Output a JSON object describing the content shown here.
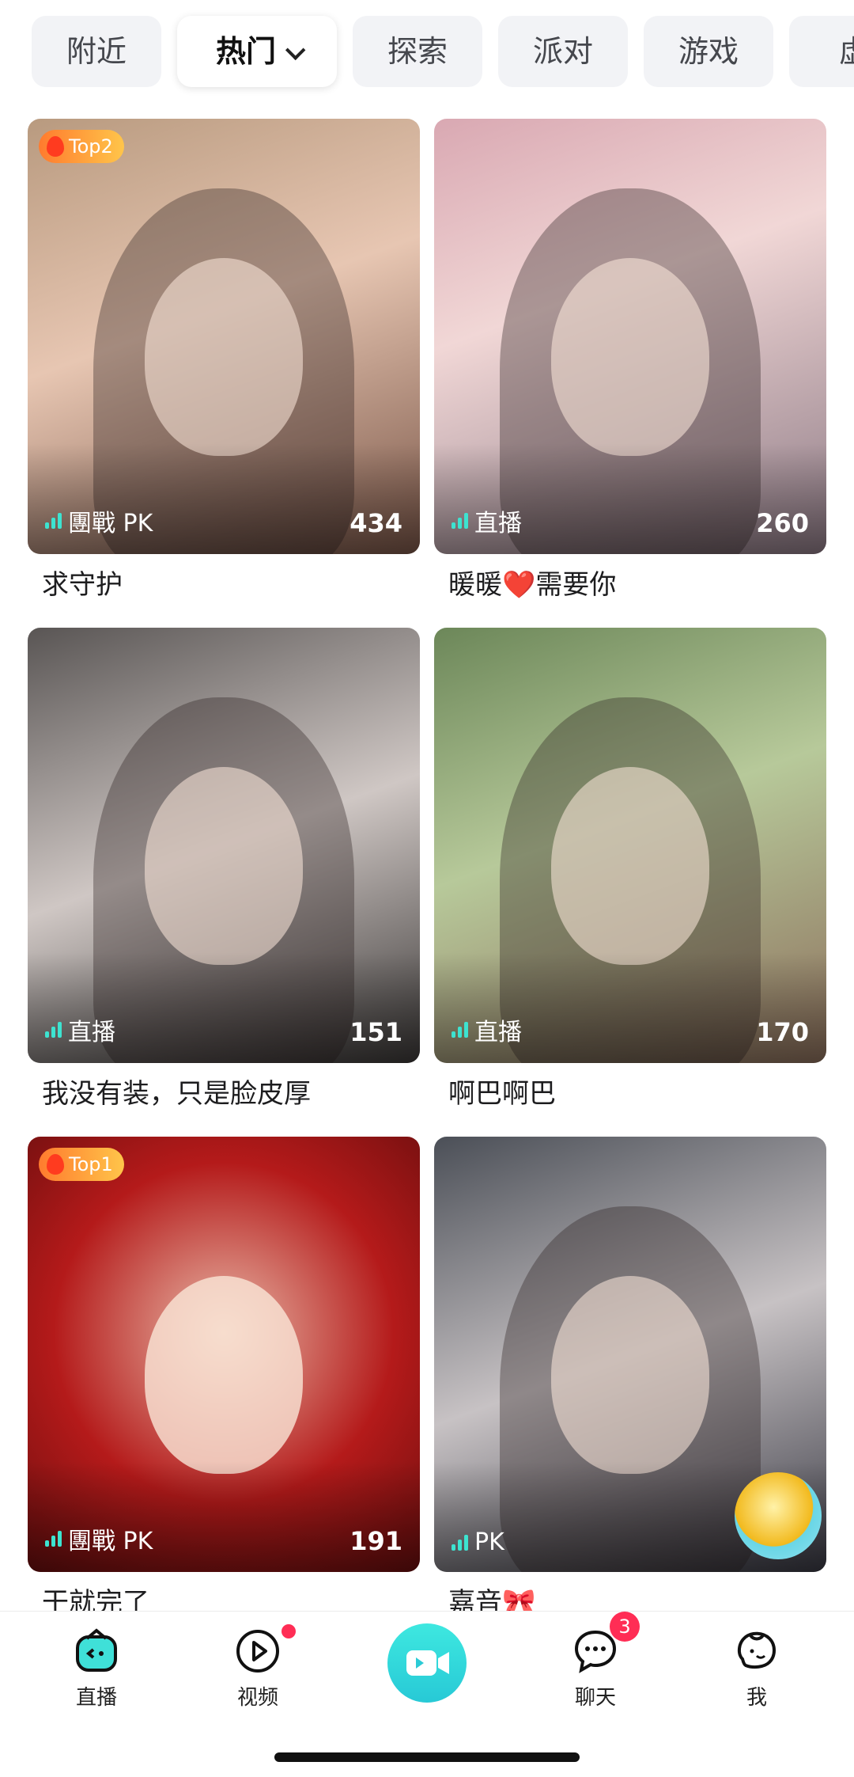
{
  "tabs": [
    {
      "label": "附近"
    },
    {
      "label": "热门"
    },
    {
      "label": "探索"
    },
    {
      "label": "派对"
    },
    {
      "label": "游戏"
    },
    {
      "label": "虚"
    }
  ],
  "cards": [
    {
      "badge": "Top2",
      "status": "團戰 PK",
      "count": "434",
      "title": "求守护"
    },
    {
      "badge": "",
      "status": "直播",
      "count": "260",
      "title_pre": "暖暖",
      "title_heart": "❤️",
      "title_post": "需要你"
    },
    {
      "badge": "",
      "status": "直播",
      "count": "151",
      "title": "我没有装，只是脸皮厚"
    },
    {
      "badge": "",
      "status": "直播",
      "count": "170",
      "title": "啊巴啊巴"
    },
    {
      "badge": "Top1",
      "status": "團戰 PK",
      "count": "191",
      "title": "干就完了"
    },
    {
      "badge": "",
      "status": "PK",
      "count": "",
      "title": "嘉音🎀"
    }
  ],
  "nav": {
    "live": "直播",
    "video": "视频",
    "chat": "聊天",
    "chat_badge": "3",
    "me": "我"
  },
  "colors": {
    "accent": "#2dd4d8",
    "badge_red": "#ff2d55"
  }
}
